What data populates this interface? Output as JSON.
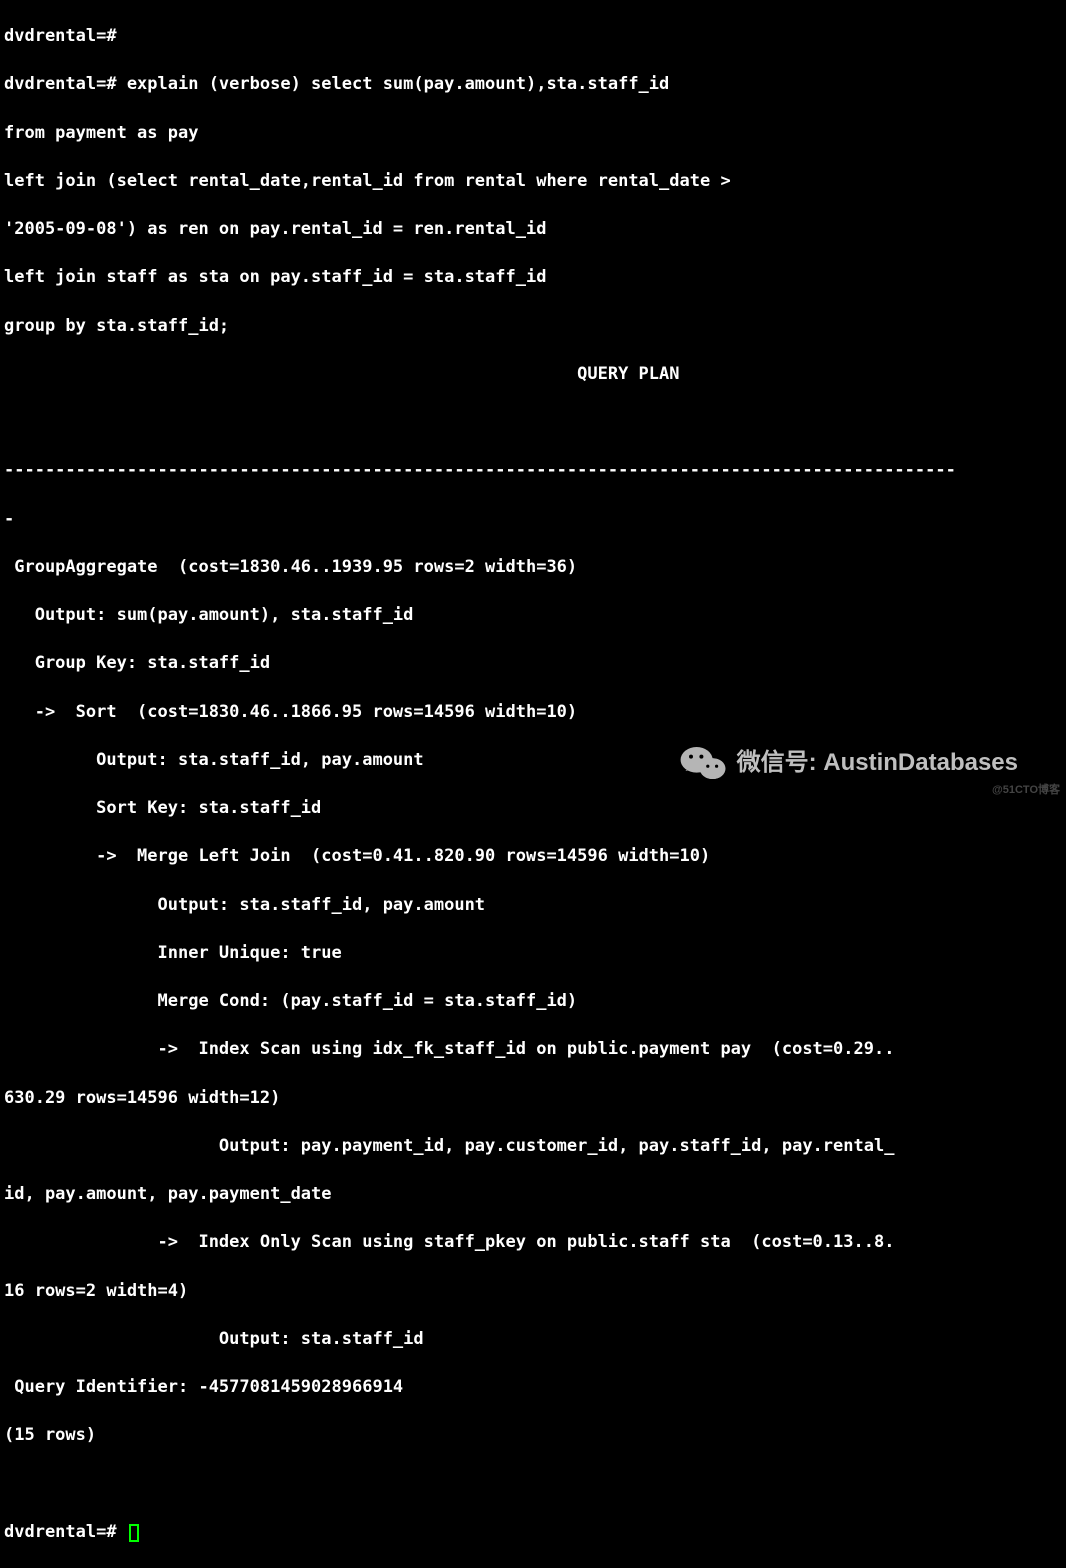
{
  "prompt": "dvdrental=#",
  "sql": {
    "l1": "dvdrental=#",
    "l2": "dvdrental=# explain (verbose) select sum(pay.amount),sta.staff_id",
    "l3": "from payment as pay",
    "l4": "left join (select rental_date,rental_id from rental where rental_date >",
    "l5": "'2005-09-08') as ren on pay.rental_id = ren.rental_id",
    "l6": "left join staff as sta on pay.staff_id = sta.staff_id",
    "l7": "group by sta.staff_id;"
  },
  "plan": {
    "header": "                                                        QUERY PLAN",
    "blank": "",
    "sep1": "---------------------------------------------------------------------------------------------",
    "sep2": "-",
    "r1": " GroupAggregate  (cost=1830.46..1939.95 rows=2 width=36)",
    "r2": "   Output: sum(pay.amount), sta.staff_id",
    "r3": "   Group Key: sta.staff_id",
    "r4": "   ->  Sort  (cost=1830.46..1866.95 rows=14596 width=10)",
    "r5": "         Output: sta.staff_id, pay.amount",
    "r6": "         Sort Key: sta.staff_id",
    "r7": "         ->  Merge Left Join  (cost=0.41..820.90 rows=14596 width=10)",
    "r8": "               Output: sta.staff_id, pay.amount",
    "r9": "               Inner Unique: true",
    "r10": "               Merge Cond: (pay.staff_id = sta.staff_id)",
    "r11": "               ->  Index Scan using idx_fk_staff_id on public.payment pay  (cost=0.29..",
    "r12": "630.29 rows=14596 width=12)",
    "r13": "                     Output: pay.payment_id, pay.customer_id, pay.staff_id, pay.rental_",
    "r14": "id, pay.amount, pay.payment_date",
    "r15": "               ->  Index Only Scan using staff_pkey on public.staff sta  (cost=0.13..8.",
    "r16": "16 rows=2 width=4)",
    "r17": "                     Output: sta.staff_id",
    "r18": " Query Identifier: -4577081459028966914",
    "r19": "(15 rows)"
  },
  "final_prompt": "dvdrental=# ",
  "watermark": {
    "label": "微信号: AustinDatabases",
    "corner": "@51CTO博客"
  }
}
